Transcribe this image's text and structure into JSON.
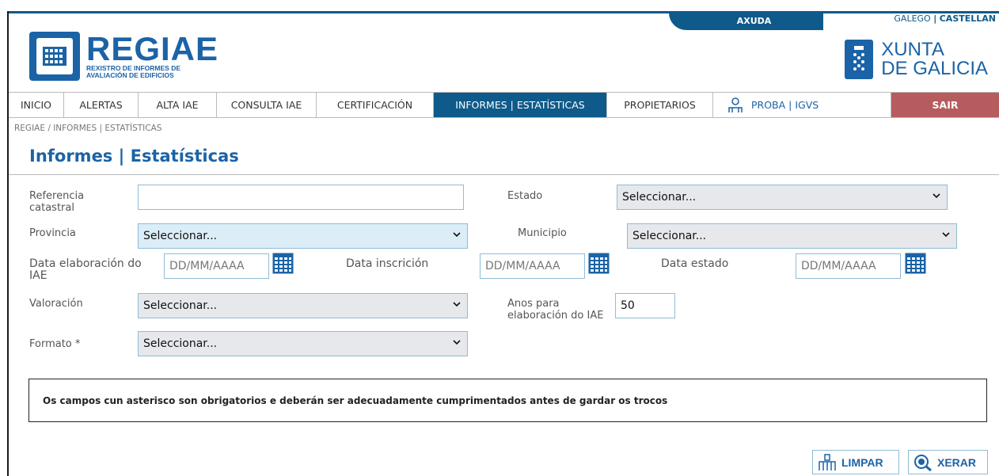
{
  "header": {
    "help_label": "AXUDA",
    "lang_galego": "GALEGO",
    "lang_sep": "|",
    "lang_castellano": "CASTELLAN",
    "logo_title": "REGIAE",
    "logo_subtitle_1": "REXISTRO DE INFORMES DE",
    "logo_subtitle_2": "AVALIACIÓN DE EDIFICIOS",
    "xunta_line1": "XUNTA",
    "xunta_line2": "DE GALICIA"
  },
  "nav": {
    "items": [
      "INICIO",
      "ALERTAS",
      "ALTA IAE",
      "CONSULTA IAE",
      "CERTIFICACIÓN",
      "INFORMES | ESTATÍSTICAS",
      "PROPIETARIOS"
    ],
    "user": "PROBA | IGVS",
    "logout": "SAIR"
  },
  "breadcrumb": "REGIAE / INFORMES | ESTATÍSTICAS",
  "page_title": "Informes | Estatísticas",
  "form": {
    "ref_label": "Referencia catastral",
    "ref_value": "",
    "estado_label": "Estado",
    "estado_value": "Seleccionar...",
    "provincia_label": "Provincia",
    "provincia_value": "Seleccionar...",
    "municipio_label": "Municipio",
    "municipio_value": "Seleccionar...",
    "data_elab_label": "Data elaboración do IAE",
    "data_insc_label": "Data inscrición",
    "data_estado_label": "Data estado",
    "date_placeholder": "DD/MM/AAAA",
    "valoracion_label": "Valoración",
    "valoracion_value": "Seleccionar...",
    "anos_label": "Anos para elaboración do IAE",
    "anos_value": "50",
    "formato_label": "Formato *",
    "formato_value": "Seleccionar..."
  },
  "note": "Os campos cun asterisco son obrigatorios e deberán ser adecuadamente cumprimentados antes de gardar os trocos",
  "buttons": {
    "clear": "LIMPAR",
    "generate": "XERAR"
  },
  "colors": {
    "primary": "#1b63a6",
    "nav_active": "#0e5a8a",
    "logout": "#b75c5e"
  }
}
